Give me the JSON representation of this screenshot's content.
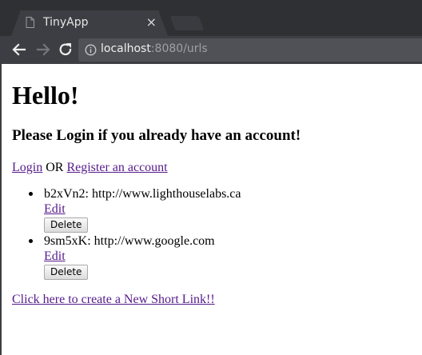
{
  "browser": {
    "tab_title": "TinyApp",
    "tab_close_glyph": "×",
    "url_host": "localhost",
    "url_path": ":8080/urls"
  },
  "page": {
    "heading": "Hello!",
    "subheading": "Please Login if you already have an account!",
    "login_link": "Login",
    "or_text": " OR ",
    "register_link": "Register an account",
    "urls": [
      {
        "text": "b2xVn2: http://www.lighthouselabs.ca",
        "edit_label": "Edit",
        "delete_label": "Delete"
      },
      {
        "text": "9sm5xK: http://www.google.com",
        "edit_label": "Edit",
        "delete_label": "Delete"
      }
    ],
    "create_link": "Click here to create a New Short Link!!"
  }
}
